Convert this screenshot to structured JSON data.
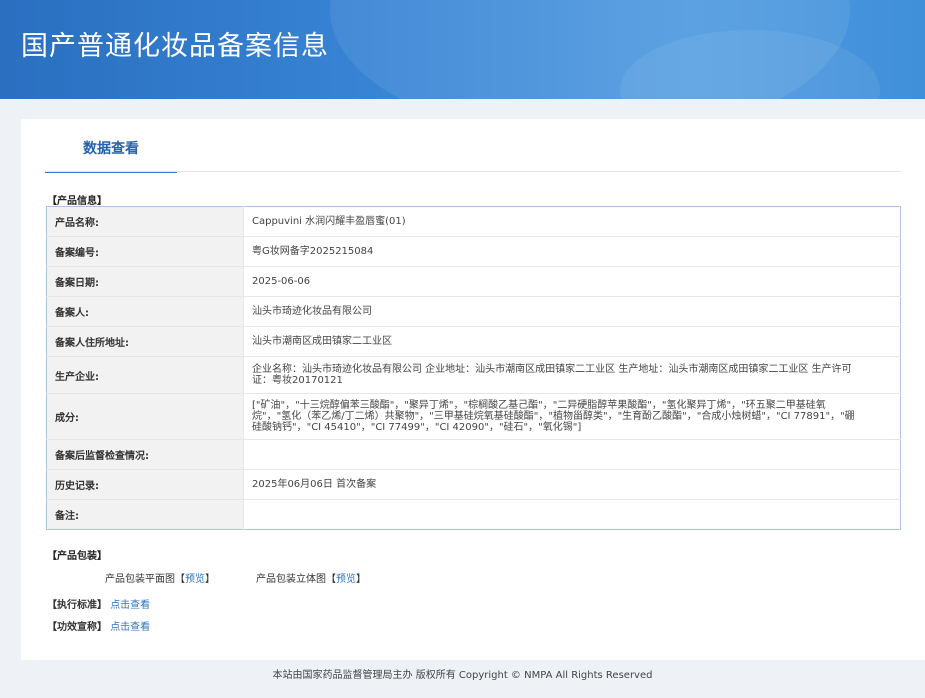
{
  "header": {
    "title": "国产普通化妆品备案信息"
  },
  "tab": {
    "label": "数据查看"
  },
  "product_info": {
    "section_label": "【产品信息】",
    "rows": [
      {
        "key": "产品名称:",
        "value": "Cappuvini 水润闪耀丰盈唇蜜(01)"
      },
      {
        "key": "备案编号:",
        "value": "粤G妆网备字2025215084"
      },
      {
        "key": "备案日期:",
        "value": "2025-06-06"
      },
      {
        "key": "备案人:",
        "value": "汕头市琦迹化妆品有限公司"
      },
      {
        "key": "备案人住所地址:",
        "value": "汕头市潮南区成田镇家二工业区"
      },
      {
        "key": "生产企业:",
        "value": "企业名称：汕头市琦迹化妆品有限公司 企业地址：汕头市潮南区成田镇家二工业区 生产地址：汕头市潮南区成田镇家二工业区 生产许可证：粤妆20170121"
      },
      {
        "key": "成分:",
        "value": "[\"矿油\"，\"十三烷醇偏苯三酸酯\"，\"聚异丁烯\"，\"棕榈酸乙基己酯\"，\"二异硬脂醇苹果酸酯\"，\"氢化聚异丁烯\"，\"环五聚二甲基硅氧烷\"，\"氢化（苯乙烯/丁二烯）共聚物\"，\"三甲基硅烷氧基硅酸酯\"，\"植物甾醇类\"，\"生育酚乙酸酯\"，\"合成小烛树蜡\"，\"CI 77891\"，\"硼硅酸钠钙\"，\"CI 45410\"，\"CI 77499\"，\"CI 42090\"，\"硅石\"，\"氧化锡\"]"
      },
      {
        "key": "备案后监督检查情况:",
        "value": ""
      },
      {
        "key": "历史记录:",
        "value": "2025年06月06日 首次备案"
      },
      {
        "key": "备注:",
        "value": ""
      }
    ]
  },
  "packaging": {
    "section_label": "【产品包装】",
    "flat_label": "产品包装平面图",
    "flat_link": "预览",
    "solid_label": "产品包装立体图",
    "solid_link": "预览",
    "bracket_open": "【",
    "bracket_close": "】"
  },
  "standard": {
    "label": "【执行标准】",
    "link": "点击查看"
  },
  "efficacy": {
    "label": "【功效宣称】",
    "link": "点击查看"
  },
  "footer": {
    "text": "本站由国家药品监督管理局主办 版权所有 Copyright © NMPA All Rights Reserved"
  }
}
